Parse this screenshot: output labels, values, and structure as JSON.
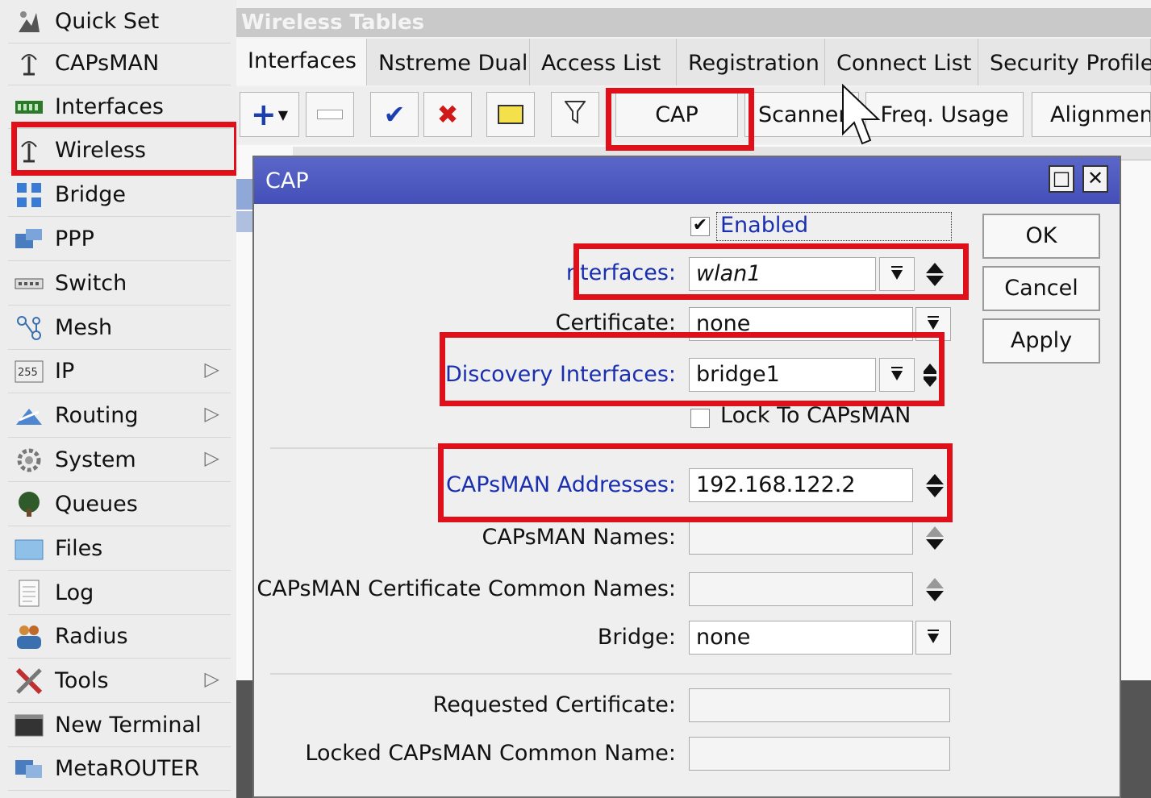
{
  "sidebar": {
    "items": [
      {
        "label": "Quick Set",
        "icon": "quick-set-icon",
        "submenu": false
      },
      {
        "label": "CAPsMAN",
        "icon": "capsman-icon",
        "submenu": false
      },
      {
        "label": "Interfaces",
        "icon": "interfaces-icon",
        "submenu": false
      },
      {
        "label": "Wireless",
        "icon": "wireless-icon",
        "submenu": false
      },
      {
        "label": "Bridge",
        "icon": "bridge-icon",
        "submenu": false
      },
      {
        "label": "PPP",
        "icon": "ppp-icon",
        "submenu": false
      },
      {
        "label": "Switch",
        "icon": "switch-icon",
        "submenu": false
      },
      {
        "label": "Mesh",
        "icon": "mesh-icon",
        "submenu": false
      },
      {
        "label": "IP",
        "icon": "ip-icon",
        "submenu": true
      },
      {
        "label": "Routing",
        "icon": "routing-icon",
        "submenu": true
      },
      {
        "label": "System",
        "icon": "system-icon",
        "submenu": true
      },
      {
        "label": "Queues",
        "icon": "queues-icon",
        "submenu": false
      },
      {
        "label": "Files",
        "icon": "files-icon",
        "submenu": false
      },
      {
        "label": "Log",
        "icon": "log-icon",
        "submenu": false
      },
      {
        "label": "Radius",
        "icon": "radius-icon",
        "submenu": false
      },
      {
        "label": "Tools",
        "icon": "tools-icon",
        "submenu": true
      },
      {
        "label": "New Terminal",
        "icon": "terminal-icon",
        "submenu": false
      },
      {
        "label": "MetaROUTER",
        "icon": "metarouter-icon",
        "submenu": false
      }
    ]
  },
  "main": {
    "title": "Wireless Tables",
    "tabs": [
      "Interfaces",
      "Nstreme Dual",
      "Access List",
      "Registration",
      "Connect List",
      "Security Profile"
    ],
    "toolbar": {
      "cap": "CAP",
      "scanner": "Scanner",
      "freq_usage": "Freq. Usage",
      "alignment": "Alignment"
    }
  },
  "dialog": {
    "title": "CAP",
    "enabled_label": "Enabled",
    "interfaces_label": "nterfaces:",
    "interfaces_value": "wlan1",
    "certificate_label": "Certificate:",
    "certificate_value": "none",
    "discovery_label": "Discovery Interfaces:",
    "discovery_value": "bridge1",
    "lock_label": "Lock To CAPsMAN",
    "addresses_label": "CAPsMAN Addresses:",
    "addresses_value": "192.168.122.2",
    "names_label": "CAPsMAN Names:",
    "names_value": "",
    "cert_names_label": "CAPsMAN Certificate Common Names:",
    "cert_names_value": "",
    "bridge_label": "Bridge:",
    "bridge_value": "none",
    "requested_cert_label": "Requested Certificate:",
    "requested_cert_value": "",
    "locked_name_label": "Locked CAPsMAN Common Name:",
    "locked_name_value": "",
    "ok": "OK",
    "cancel": "Cancel",
    "apply": "Apply"
  },
  "colors": {
    "highlight": "#e0101a",
    "titlebar": "#4e5ac0",
    "link_label": "#1a2fb0"
  }
}
